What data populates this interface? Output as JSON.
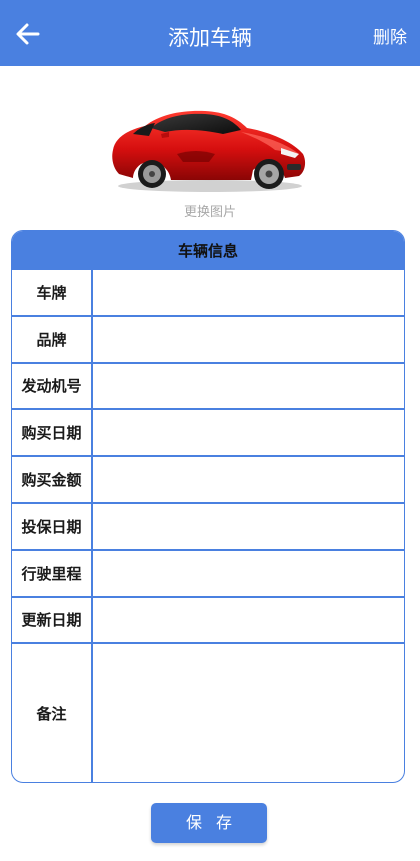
{
  "appbar": {
    "back_icon": "arrow-left-icon",
    "title": "添加车辆",
    "delete_label": "删除",
    "color": "#4a80e0"
  },
  "photo": {
    "image": "red-sports-car",
    "change_label": "更换图片"
  },
  "info": {
    "header": "车辆信息",
    "fields": [
      {
        "label": "车牌",
        "value": ""
      },
      {
        "label": "品牌",
        "value": ""
      },
      {
        "label": "发动机号",
        "value": ""
      },
      {
        "label": "购买日期",
        "value": ""
      },
      {
        "label": "购买金额",
        "value": ""
      },
      {
        "label": "投保日期",
        "value": ""
      },
      {
        "label": "行驶里程",
        "value": ""
      },
      {
        "label": "更新日期",
        "value": ""
      },
      {
        "label": "备注",
        "value": ""
      }
    ]
  },
  "save_label": "保存"
}
